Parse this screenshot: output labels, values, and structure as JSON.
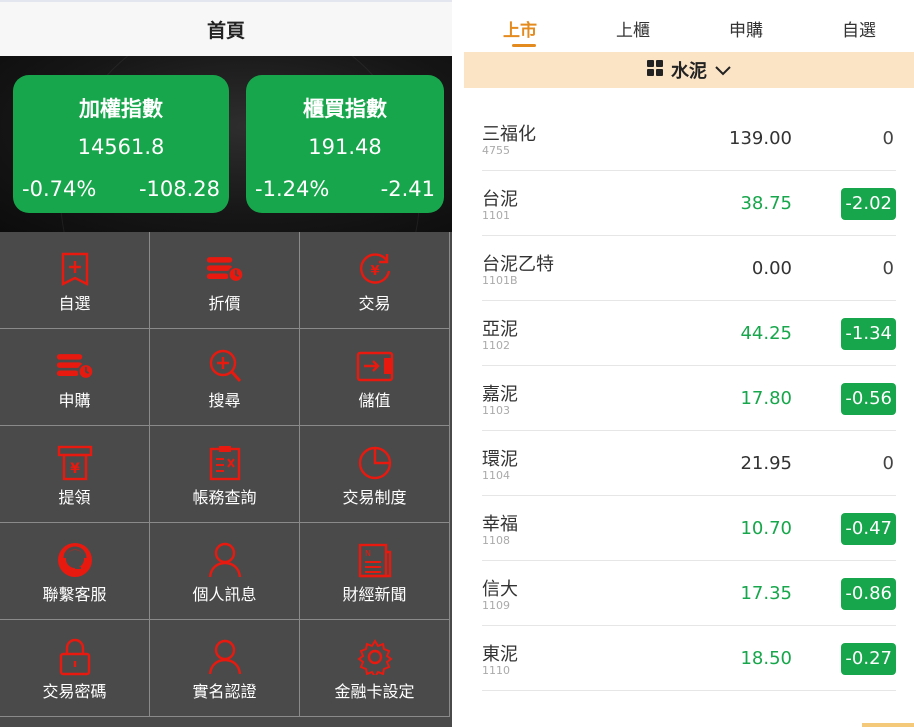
{
  "left": {
    "title": "首頁",
    "cards": [
      {
        "name": "加權指數",
        "value": "14561.8",
        "pct": "-0.74%",
        "change": "-108.28"
      },
      {
        "name": "櫃買指數",
        "value": "191.48",
        "pct": "-1.24%",
        "change": "-2.41"
      }
    ],
    "menu": [
      {
        "label": "自選",
        "icon": "favorite-list-icon"
      },
      {
        "label": "折價",
        "icon": "discount-coins-icon"
      },
      {
        "label": "交易",
        "icon": "yen-exchange-icon"
      },
      {
        "label": "申購",
        "icon": "subscribe-coins-icon"
      },
      {
        "label": "搜尋",
        "icon": "search-icon"
      },
      {
        "label": "儲值",
        "icon": "wallet-icon"
      },
      {
        "label": "提領",
        "icon": "atm-withdraw-icon"
      },
      {
        "label": "帳務查詢",
        "icon": "ledger-icon"
      },
      {
        "label": "交易制度",
        "icon": "pie-chart-icon"
      },
      {
        "label": "聯繫客服",
        "icon": "customer-service-icon"
      },
      {
        "label": "個人訊息",
        "icon": "user-icon"
      },
      {
        "label": "財經新聞",
        "icon": "news-icon"
      },
      {
        "label": "交易密碼",
        "icon": "lock-icon"
      },
      {
        "label": "實名認證",
        "icon": "user-verify-icon"
      },
      {
        "label": "金融卡設定",
        "icon": "gear-icon"
      }
    ],
    "colors": {
      "accent": "#17a64b",
      "icon": "#e8190f",
      "grid_bg": "#4a4a4a"
    }
  },
  "right": {
    "tabs": [
      "上市",
      "上櫃",
      "申購",
      "自選"
    ],
    "active_tab": "上市",
    "category": "水泥",
    "stocks": [
      {
        "name": "三福化",
        "code": "4755",
        "price": "139.00",
        "change": "0"
      },
      {
        "name": "台泥",
        "code": "1101",
        "price": "38.75",
        "change": "-2.02"
      },
      {
        "name": "台泥乙特",
        "code": "1101B",
        "price": "0.00",
        "change": "0"
      },
      {
        "name": "亞泥",
        "code": "1102",
        "price": "44.25",
        "change": "-1.34"
      },
      {
        "name": "嘉泥",
        "code": "1103",
        "price": "17.80",
        "change": "-0.56"
      },
      {
        "name": "環泥",
        "code": "1104",
        "price": "21.95",
        "change": "0"
      },
      {
        "name": "幸福",
        "code": "1108",
        "price": "10.70",
        "change": "-0.47"
      },
      {
        "name": "信大",
        "code": "1109",
        "price": "17.35",
        "change": "-0.86"
      },
      {
        "name": "東泥",
        "code": "1110",
        "price": "18.50",
        "change": "-0.27"
      }
    ],
    "colors": {
      "tab_active": "#e48b1f",
      "subbar": "#fbe3c6",
      "down": "#17a64b"
    }
  }
}
